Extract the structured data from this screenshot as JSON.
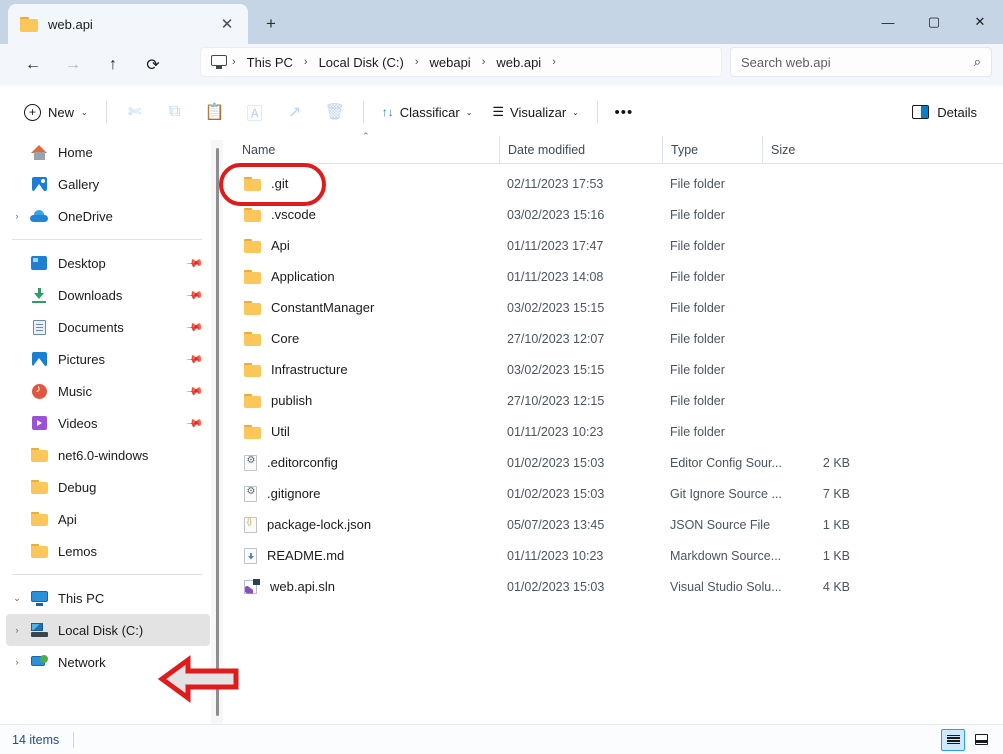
{
  "window": {
    "tab": {
      "title": "web.api",
      "folder_icon": "folder-icon",
      "close_icon": "✕"
    },
    "new_tab_icon": "+",
    "controls": {
      "minimize": "—",
      "maximize": "▢",
      "close": "✕"
    }
  },
  "nav": {
    "back_icon": "←",
    "forward_icon": "→",
    "up_icon": "↑",
    "refresh_icon": "⟳",
    "breadcrumb": {
      "root_icon": "this-pc-icon",
      "separator": "›",
      "items": [
        "This PC",
        "Local Disk (C:)",
        "webapi",
        "web.api"
      ]
    },
    "search": {
      "placeholder": "Search web.api",
      "icon": "⌕"
    }
  },
  "toolbar": {
    "new_label": "New",
    "new_plus": "+",
    "chevron": "⌄",
    "cut_icon": "✄",
    "copy_icon": "⧉",
    "paste_icon": "📋",
    "rename_icon": "🄰",
    "share_icon": "↗",
    "delete_icon": "🗑",
    "sort_label": "Classificar",
    "sort_icon": "↑↓",
    "view_label": "Visualizar",
    "view_icon": "☰",
    "more_label": "•••",
    "details_label": "Details"
  },
  "sidebar": {
    "groups": [
      {
        "items": [
          {
            "label": "Home",
            "icon": "home-icon",
            "expandable": false,
            "pinned": false
          },
          {
            "label": "Gallery",
            "icon": "gallery-icon",
            "expandable": false,
            "pinned": false
          },
          {
            "label": "OneDrive",
            "icon": "onedrive-cloud-icon",
            "expandable": true,
            "pinned": false
          }
        ]
      },
      {
        "items": [
          {
            "label": "Desktop",
            "icon": "desktop-icon",
            "expandable": false,
            "pinned": true
          },
          {
            "label": "Downloads",
            "icon": "downloads-icon",
            "expandable": false,
            "pinned": true
          },
          {
            "label": "Documents",
            "icon": "documents-icon",
            "expandable": false,
            "pinned": true
          },
          {
            "label": "Pictures",
            "icon": "pictures-icon",
            "expandable": false,
            "pinned": true
          },
          {
            "label": "Music",
            "icon": "music-icon",
            "expandable": false,
            "pinned": true
          },
          {
            "label": "Videos",
            "icon": "videos-icon",
            "expandable": false,
            "pinned": true
          },
          {
            "label": "net6.0-windows",
            "icon": "folder-icon",
            "expandable": false,
            "pinned": false
          },
          {
            "label": "Debug",
            "icon": "folder-icon",
            "expandable": false,
            "pinned": false
          },
          {
            "label": "Api",
            "icon": "folder-icon",
            "expandable": false,
            "pinned": false
          },
          {
            "label": "Lemos",
            "icon": "folder-icon",
            "expandable": false,
            "pinned": false
          }
        ]
      },
      {
        "items": [
          {
            "label": "This PC",
            "icon": "this-pc-icon",
            "expandable": true,
            "expanded": true,
            "pinned": false
          },
          {
            "label": "Local Disk (C:)",
            "icon": "local-disk-icon",
            "expandable": true,
            "pinned": false,
            "selected": true
          },
          {
            "label": "Network",
            "icon": "network-icon",
            "expandable": true,
            "pinned": false
          }
        ]
      }
    ],
    "expand_collapsed": "›",
    "expand_open": "⌄",
    "pin_glyph": "📌"
  },
  "filelist": {
    "columns": [
      "Name",
      "Date modified",
      "Type",
      "Size"
    ],
    "sort_indicator": "⌃",
    "rows": [
      {
        "name": ".git",
        "date": "02/11/2023 17:53",
        "type": "File folder",
        "size": "",
        "icon": "folder-icon"
      },
      {
        "name": ".vscode",
        "date": "03/02/2023 15:16",
        "type": "File folder",
        "size": "",
        "icon": "folder-icon"
      },
      {
        "name": "Api",
        "date": "01/11/2023 17:47",
        "type": "File folder",
        "size": "",
        "icon": "folder-icon"
      },
      {
        "name": "Application",
        "date": "01/11/2023 14:08",
        "type": "File folder",
        "size": "",
        "icon": "folder-icon"
      },
      {
        "name": "ConstantManager",
        "date": "03/02/2023 15:15",
        "type": "File folder",
        "size": "",
        "icon": "folder-icon"
      },
      {
        "name": "Core",
        "date": "27/10/2023 12:07",
        "type": "File folder",
        "size": "",
        "icon": "folder-icon"
      },
      {
        "name": "Infrastructure",
        "date": "03/02/2023 15:15",
        "type": "File folder",
        "size": "",
        "icon": "folder-icon"
      },
      {
        "name": "publish",
        "date": "27/10/2023 12:15",
        "type": "File folder",
        "size": "",
        "icon": "folder-icon"
      },
      {
        "name": "Util",
        "date": "01/11/2023 10:23",
        "type": "File folder",
        "size": "",
        "icon": "folder-icon"
      },
      {
        "name": ".editorconfig",
        "date": "01/02/2023 15:03",
        "type": "Editor Config Sour...",
        "size": "2 KB",
        "icon": "config-file-icon"
      },
      {
        "name": ".gitignore",
        "date": "01/02/2023 15:03",
        "type": "Git Ignore Source ...",
        "size": "7 KB",
        "icon": "config-file-icon"
      },
      {
        "name": "package-lock.json",
        "date": "05/07/2023 13:45",
        "type": "JSON Source File",
        "size": "1 KB",
        "icon": "json-file-icon"
      },
      {
        "name": "README.md",
        "date": "01/11/2023 10:23",
        "type": "Markdown Source...",
        "size": "1 KB",
        "icon": "markdown-file-icon"
      },
      {
        "name": "web.api.sln",
        "date": "01/02/2023 15:03",
        "type": "Visual Studio Solu...",
        "size": "4 KB",
        "icon": "visual-studio-solution-icon"
      }
    ]
  },
  "statusbar": {
    "item_count": "14 items",
    "view_details_icon": "details-view-icon",
    "view_tiles_icon": "large-icons-view-icon"
  },
  "annotations": {
    "color": "#e01b1b",
    "highlight_target": ".git",
    "arrow_target": "Local Disk (C:)"
  }
}
